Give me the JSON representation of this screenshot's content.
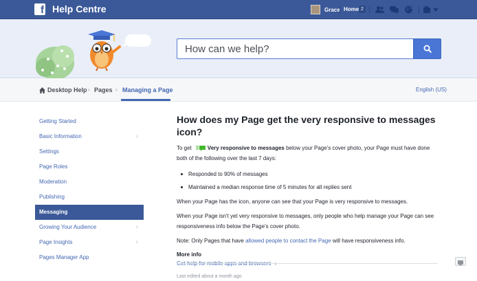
{
  "topbar": {
    "title": "Help Centre",
    "user_name": "Grace",
    "home_label": "Home",
    "home_count": "2",
    "icons": [
      "friend-requests-icon",
      "messages-icon",
      "notifications-globe-icon",
      "account-settings-icon",
      "dropdown-arrow-icon"
    ]
  },
  "search": {
    "placeholder": "How can we help?"
  },
  "breadcrumb": {
    "items": [
      "Desktop Help",
      "Pages",
      "Managing a Page"
    ],
    "language": "English (US)"
  },
  "sidebar": {
    "items": [
      {
        "label": "Getting Started",
        "has_chevron": false
      },
      {
        "label": "Basic Information",
        "has_chevron": true
      },
      {
        "label": "Settings",
        "has_chevron": false
      },
      {
        "label": "Page Roles",
        "has_chevron": false
      },
      {
        "label": "Moderation",
        "has_chevron": false
      },
      {
        "label": "Publishing",
        "has_chevron": false
      },
      {
        "label": "Messaging",
        "has_chevron": false,
        "active": true
      },
      {
        "label": "Growing Your Audience",
        "has_chevron": true
      },
      {
        "label": "Page Insights",
        "has_chevron": true
      },
      {
        "label": "Pages Manager App",
        "has_chevron": false
      }
    ]
  },
  "article": {
    "title": "How does my Page get the very responsive to messages icon?",
    "intro_prefix": "To get",
    "intro_bold": "Very responsive to messages",
    "intro_suffix": "below your Page's cover photo, your Page must have done both of the following over the last 7 days:",
    "bullets": [
      "Responded to 90% of messages",
      "Maintained a median response time of 5 minutes for all replies sent"
    ],
    "para1": "When your Page has the icon, anyone can see that your Page is very responsive to messages.",
    "para2": "When your Page isn't yet very responsive to messages, only people who help manage your Page can see responsiveness info below the Page's cover photo.",
    "note_prefix": "Note: Only Pages that have",
    "note_link": "allowed people to contact the Page",
    "note_suffix": "will have responsiveness info.",
    "more_info_title": "More info",
    "more_info_link": "Get help for mobile apps and browsers",
    "last_edited": "Last edited about a month ago"
  },
  "colors": {
    "brand": "#3b5998",
    "link": "#4267b2",
    "search_button": "#4a76d6",
    "hero_bg": "#e9eef8",
    "responsive_icon": "#42b72a"
  }
}
